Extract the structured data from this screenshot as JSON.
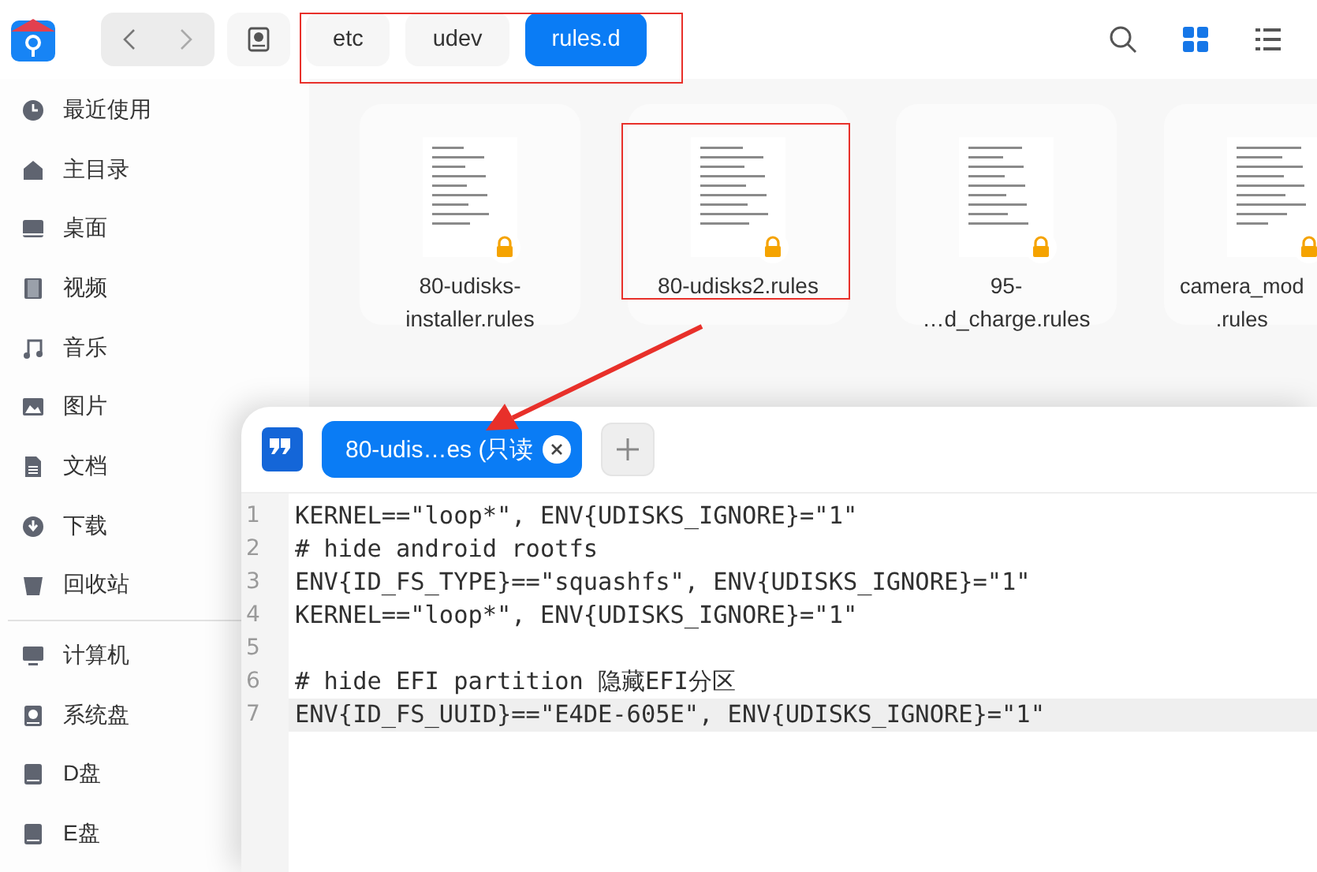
{
  "toolbar": {
    "breadcrumbs": [
      {
        "label": "etc",
        "selected": false
      },
      {
        "label": "udev",
        "selected": false
      },
      {
        "label": "rules.d",
        "selected": true
      }
    ],
    "view_modes": [
      {
        "selected": true
      },
      {
        "selected": false
      }
    ]
  },
  "sidebar": {
    "groups": [
      {
        "items": [
          {
            "label": "最近使用"
          },
          {
            "label": "主目录"
          },
          {
            "label": "桌面"
          },
          {
            "label": "视频"
          },
          {
            "label": "音乐"
          },
          {
            "label": "图片"
          },
          {
            "label": "文档"
          },
          {
            "label": "下载"
          },
          {
            "label": "回收站"
          }
        ]
      },
      {
        "items": [
          {
            "label": "计算机"
          },
          {
            "label": "系统盘"
          },
          {
            "label": "D盘"
          },
          {
            "label": "E盘"
          }
        ]
      }
    ]
  },
  "files": [
    {
      "name_lines": [
        "80-udisks-",
        "installer.rules"
      ],
      "locked": true
    },
    {
      "name_lines": [
        "80-udisks2.rules"
      ],
      "locked": true
    },
    {
      "name_lines": [
        "95-",
        "…d_charge.rules"
      ],
      "locked": true
    },
    {
      "name_lines": [
        "camera_mod",
        ".rules"
      ],
      "locked": true
    }
  ],
  "editor": {
    "tabs": [
      {
        "label": "80-udis…es (只读",
        "selected": true
      }
    ],
    "lines": [
      {
        "number": "1",
        "text": "KERNEL==\"loop*\", ENV{UDISKS_IGNORE}=\"1\"",
        "current": false
      },
      {
        "number": "2",
        "text": "# hide android rootfs",
        "current": false
      },
      {
        "number": "3",
        "text": "ENV{ID_FS_TYPE}==\"squashfs\", ENV{UDISKS_IGNORE}=\"1\"",
        "current": false
      },
      {
        "number": "4",
        "text": "KERNEL==\"loop*\", ENV{UDISKS_IGNORE}=\"1\"",
        "current": false
      },
      {
        "number": "5",
        "current": false
      },
      {
        "number": "6",
        "text": "# hide EFI partition 隐藏EFI分区",
        "current": false
      },
      {
        "number": "7",
        "text": "ENV{ID_FS_UUID}==\"E4DE-605E\", ENV{UDISKS_IGNORE}=\"1\"",
        "current": true
      }
    ]
  }
}
